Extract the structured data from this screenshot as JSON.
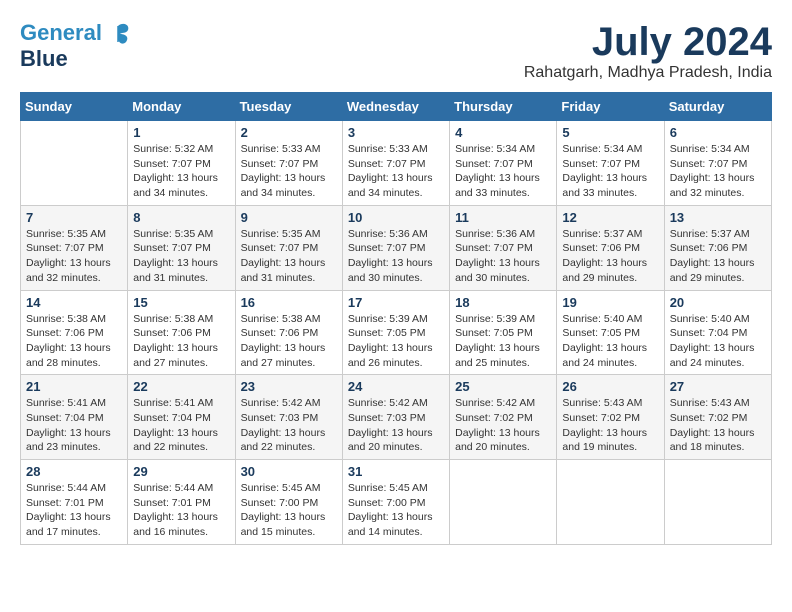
{
  "header": {
    "logo_line1": "General",
    "logo_line2": "Blue",
    "month_year": "July 2024",
    "location": "Rahatgarh, Madhya Pradesh, India"
  },
  "days_of_week": [
    "Sunday",
    "Monday",
    "Tuesday",
    "Wednesday",
    "Thursday",
    "Friday",
    "Saturday"
  ],
  "weeks": [
    [
      {
        "day": "",
        "info": ""
      },
      {
        "day": "1",
        "info": "Sunrise: 5:32 AM\nSunset: 7:07 PM\nDaylight: 13 hours\nand 34 minutes."
      },
      {
        "day": "2",
        "info": "Sunrise: 5:33 AM\nSunset: 7:07 PM\nDaylight: 13 hours\nand 34 minutes."
      },
      {
        "day": "3",
        "info": "Sunrise: 5:33 AM\nSunset: 7:07 PM\nDaylight: 13 hours\nand 34 minutes."
      },
      {
        "day": "4",
        "info": "Sunrise: 5:34 AM\nSunset: 7:07 PM\nDaylight: 13 hours\nand 33 minutes."
      },
      {
        "day": "5",
        "info": "Sunrise: 5:34 AM\nSunset: 7:07 PM\nDaylight: 13 hours\nand 33 minutes."
      },
      {
        "day": "6",
        "info": "Sunrise: 5:34 AM\nSunset: 7:07 PM\nDaylight: 13 hours\nand 32 minutes."
      }
    ],
    [
      {
        "day": "7",
        "info": "Sunrise: 5:35 AM\nSunset: 7:07 PM\nDaylight: 13 hours\nand 32 minutes."
      },
      {
        "day": "8",
        "info": "Sunrise: 5:35 AM\nSunset: 7:07 PM\nDaylight: 13 hours\nand 31 minutes."
      },
      {
        "day": "9",
        "info": "Sunrise: 5:35 AM\nSunset: 7:07 PM\nDaylight: 13 hours\nand 31 minutes."
      },
      {
        "day": "10",
        "info": "Sunrise: 5:36 AM\nSunset: 7:07 PM\nDaylight: 13 hours\nand 30 minutes."
      },
      {
        "day": "11",
        "info": "Sunrise: 5:36 AM\nSunset: 7:07 PM\nDaylight: 13 hours\nand 30 minutes."
      },
      {
        "day": "12",
        "info": "Sunrise: 5:37 AM\nSunset: 7:06 PM\nDaylight: 13 hours\nand 29 minutes."
      },
      {
        "day": "13",
        "info": "Sunrise: 5:37 AM\nSunset: 7:06 PM\nDaylight: 13 hours\nand 29 minutes."
      }
    ],
    [
      {
        "day": "14",
        "info": "Sunrise: 5:38 AM\nSunset: 7:06 PM\nDaylight: 13 hours\nand 28 minutes."
      },
      {
        "day": "15",
        "info": "Sunrise: 5:38 AM\nSunset: 7:06 PM\nDaylight: 13 hours\nand 27 minutes."
      },
      {
        "day": "16",
        "info": "Sunrise: 5:38 AM\nSunset: 7:06 PM\nDaylight: 13 hours\nand 27 minutes."
      },
      {
        "day": "17",
        "info": "Sunrise: 5:39 AM\nSunset: 7:05 PM\nDaylight: 13 hours\nand 26 minutes."
      },
      {
        "day": "18",
        "info": "Sunrise: 5:39 AM\nSunset: 7:05 PM\nDaylight: 13 hours\nand 25 minutes."
      },
      {
        "day": "19",
        "info": "Sunrise: 5:40 AM\nSunset: 7:05 PM\nDaylight: 13 hours\nand 24 minutes."
      },
      {
        "day": "20",
        "info": "Sunrise: 5:40 AM\nSunset: 7:04 PM\nDaylight: 13 hours\nand 24 minutes."
      }
    ],
    [
      {
        "day": "21",
        "info": "Sunrise: 5:41 AM\nSunset: 7:04 PM\nDaylight: 13 hours\nand 23 minutes."
      },
      {
        "day": "22",
        "info": "Sunrise: 5:41 AM\nSunset: 7:04 PM\nDaylight: 13 hours\nand 22 minutes."
      },
      {
        "day": "23",
        "info": "Sunrise: 5:42 AM\nSunset: 7:03 PM\nDaylight: 13 hours\nand 22 minutes."
      },
      {
        "day": "24",
        "info": "Sunrise: 5:42 AM\nSunset: 7:03 PM\nDaylight: 13 hours\nand 20 minutes."
      },
      {
        "day": "25",
        "info": "Sunrise: 5:42 AM\nSunset: 7:02 PM\nDaylight: 13 hours\nand 20 minutes."
      },
      {
        "day": "26",
        "info": "Sunrise: 5:43 AM\nSunset: 7:02 PM\nDaylight: 13 hours\nand 19 minutes."
      },
      {
        "day": "27",
        "info": "Sunrise: 5:43 AM\nSunset: 7:02 PM\nDaylight: 13 hours\nand 18 minutes."
      }
    ],
    [
      {
        "day": "28",
        "info": "Sunrise: 5:44 AM\nSunset: 7:01 PM\nDaylight: 13 hours\nand 17 minutes."
      },
      {
        "day": "29",
        "info": "Sunrise: 5:44 AM\nSunset: 7:01 PM\nDaylight: 13 hours\nand 16 minutes."
      },
      {
        "day": "30",
        "info": "Sunrise: 5:45 AM\nSunset: 7:00 PM\nDaylight: 13 hours\nand 15 minutes."
      },
      {
        "day": "31",
        "info": "Sunrise: 5:45 AM\nSunset: 7:00 PM\nDaylight: 13 hours\nand 14 minutes."
      },
      {
        "day": "",
        "info": ""
      },
      {
        "day": "",
        "info": ""
      },
      {
        "day": "",
        "info": ""
      }
    ]
  ]
}
